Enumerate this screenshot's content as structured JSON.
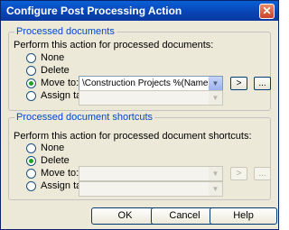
{
  "window": {
    "title": "Configure Post Processing Action",
    "close_glyph": "✕"
  },
  "processed": {
    "legend": "Processed documents",
    "instruction": "Perform this action for processed documents:",
    "options": [
      "None",
      "Delete",
      "Move to:",
      "Assign tag"
    ],
    "selected": "Move to:",
    "move_path": "\\Construction Projects %(Name)",
    "insert_button": ">",
    "browse_button": "..."
  },
  "shortcuts": {
    "legend": "Processed document shortcuts",
    "instruction": "Perform this action for processed document shortcuts:",
    "options": [
      "None",
      "Delete",
      "Move to:",
      "Assign tag"
    ],
    "selected": "Delete",
    "insert_button": ">",
    "browse_button": "..."
  },
  "buttons": {
    "ok": "OK",
    "cancel": "Cancel",
    "help": "Help"
  },
  "icons": {
    "dropdown": "chevron-down-icon"
  }
}
